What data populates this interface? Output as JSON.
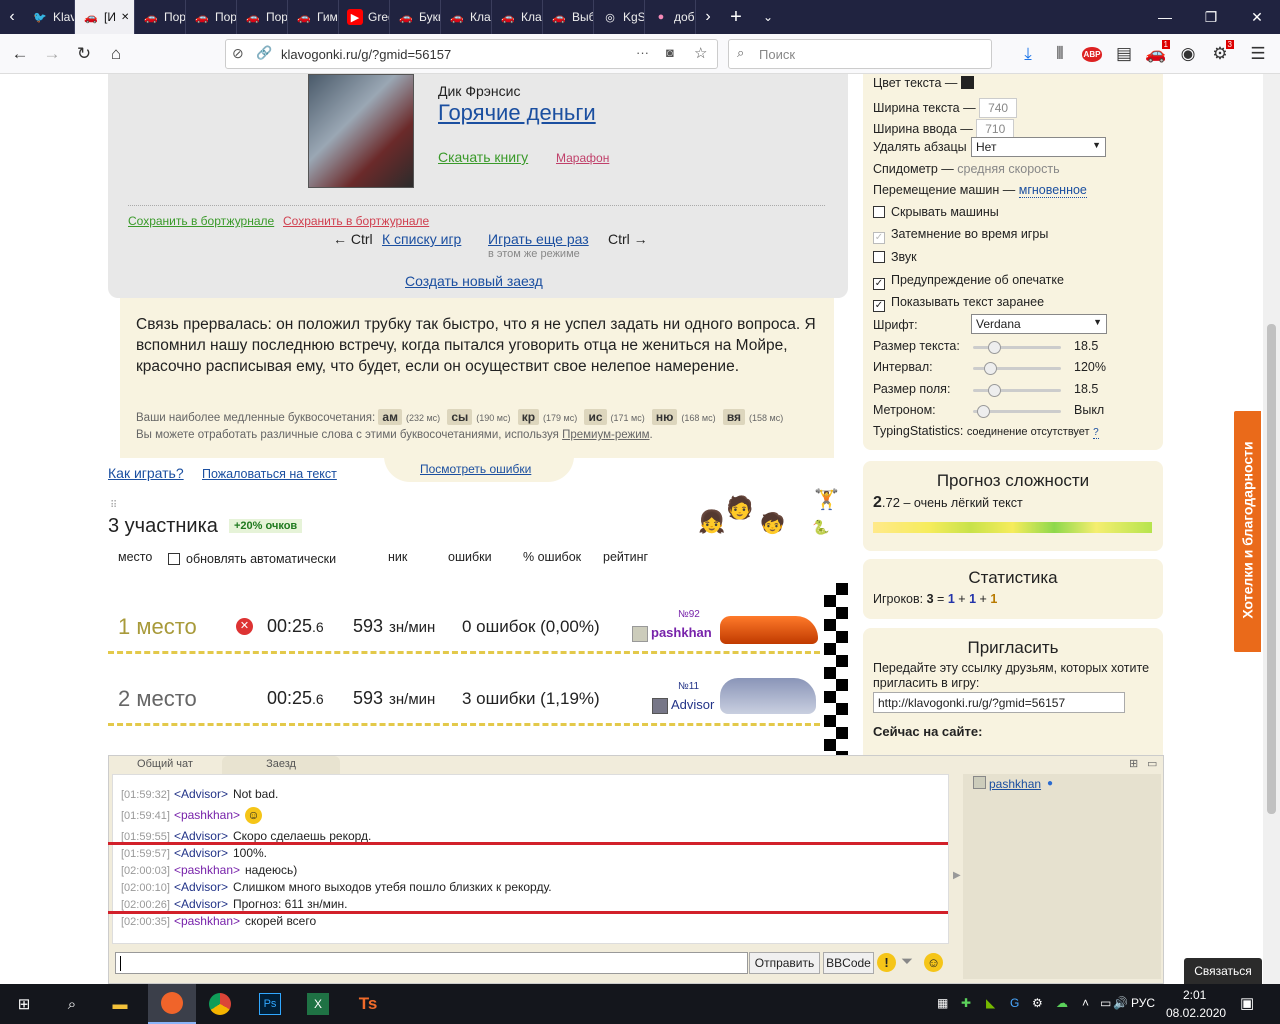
{
  "browser": {
    "tabs": [
      {
        "label": "Klavo",
        "icon": "twitter-icon"
      },
      {
        "label": "[И",
        "icon": "klavogonki-icon",
        "active": true
      },
      {
        "label": "Пора",
        "icon": "klavogonki-icon"
      },
      {
        "label": "Пора",
        "icon": "klavogonki-icon"
      },
      {
        "label": "Пора",
        "icon": "klavogonki-icon"
      },
      {
        "label": "Гимна",
        "icon": "klavogonki-icon"
      },
      {
        "label": "Greg I",
        "icon": "youtube-icon"
      },
      {
        "label": "Буквы",
        "icon": "klavogonki-icon"
      },
      {
        "label": "Клаво",
        "icon": "klavogonki-icon"
      },
      {
        "label": "Клаво",
        "icon": "klavogonki-icon"
      },
      {
        "label": "Выбор",
        "icon": "klavogonki-icon"
      },
      {
        "label": "KgScri",
        "icon": "github-icon"
      },
      {
        "label": "добро",
        "icon": "pink-circle-icon"
      }
    ],
    "url": "klavogonki.ru/g/?gmid=56157",
    "search_placeholder": "Поиск",
    "badge_a": "1",
    "badge_b": "3"
  },
  "book": {
    "author": "Дик Фрэнсис",
    "title": "Горячие деньги",
    "download": "Скачать книгу",
    "mode": "Марафон"
  },
  "actions": {
    "save_green": "Сохранить в бортжурнале",
    "save_red": "Сохранить в бортжурнале",
    "prev_hint": "← Ctrl",
    "to_list": "К списку игр",
    "play_again": "Играть еще раз",
    "next_hint": "Ctrl →",
    "same_mode": "в этом же режиме",
    "new_race": "Создать новый заезд"
  },
  "text_panel": {
    "quote": "Связь прервалась: он положил трубку так быстро, что я не успел задать ни одного вопроса. Я вспомнил нашу последнюю встречу, когда пытался уговорить отца не жениться на Мойре, красочно расписывая ему, что будет, если он осуществит свое нелепое намерение.",
    "slow_label": "Ваши наиболее медленные буквосочетания:",
    "combos": [
      {
        "k": "ам",
        "ms": "(232 мс)"
      },
      {
        "k": "сы",
        "ms": "(190 мс)"
      },
      {
        "k": "кр",
        "ms": "(179 мс)"
      },
      {
        "k": "ис",
        "ms": "(171 мс)"
      },
      {
        "k": "ню",
        "ms": "(168 мс)"
      },
      {
        "k": "вя",
        "ms": "(158 мс)"
      }
    ],
    "practice_pre": "Вы можете отработать различные слова с этими буквосочетаниями, используя",
    "practice_link": "Премиум-режим",
    "practice_post": "."
  },
  "links": {
    "how_to_play": "Как играть?",
    "complain": "Пожаловаться на текст",
    "view_errors": "Посмотреть ошибки"
  },
  "participants": {
    "title": "3 участника",
    "bonus": "+20% очков",
    "cols": {
      "place": "место",
      "auto": "обновлять автоматически",
      "nick": "ник",
      "errors": "ошибки",
      "err_pct": "% ошибок",
      "rating": "рейтинг"
    }
  },
  "results": [
    {
      "place": "1 место",
      "time": "00:25",
      "frac": ".6",
      "speed": "593",
      "unit": "зн/мин",
      "errors": "0 ошибок (0,00%)",
      "num": "№92",
      "nick": "pashkhan"
    },
    {
      "place": "2 место",
      "time": "00:25",
      "frac": ".6",
      "speed": "593",
      "unit": "зн/мин",
      "errors": "3 ошибки (1,19%)",
      "num": "№11",
      "nick": "Advisor"
    }
  ],
  "settings": {
    "text_color": "Цвет текста —",
    "text_width": "Ширина текста —",
    "text_width_val": "740",
    "input_width": "Ширина ввода —",
    "input_width_val": "710",
    "remove_par": "Удалять абзацы",
    "remove_par_val": "Нет",
    "speedometer": "Спидометр —",
    "speedometer_val": "средняя скорость",
    "car_move": "Перемещение машин —",
    "car_move_val": "мгновенное",
    "hide_cars": "Скрывать машины",
    "dim": "Затемнение во время игры",
    "sound": "Звук",
    "typo_warn": "Предупреждение об опечатке",
    "show_text": "Показывать текст заранее",
    "font": "Шрифт:",
    "font_val": "Verdana",
    "text_size": "Размер текста:",
    "text_size_val": "18.5",
    "text_size_level": 0.2,
    "interval": "Интервал:",
    "interval_val": "120%",
    "interval_level": 0.15,
    "field_size": "Размер поля:",
    "field_size_val": "18.5",
    "field_size_level": 0.2,
    "metronome": "Метроном:",
    "metronome_val": "Выкл",
    "metronome_level": 0.05,
    "typing_stats": "TypingStatistics:",
    "typing_stats_val": "соединение отсутствует",
    "typing_stats_q": "?"
  },
  "forecast": {
    "title": "Прогноз сложности",
    "value_big": "2",
    "value_small": ".72",
    "desc": "– очень лёгкий текст"
  },
  "stats": {
    "title": "Статистика",
    "label": "Игроков:",
    "total": "3",
    "eq": "=",
    "a": "1",
    "b": "1",
    "c": "1",
    "plus": "+"
  },
  "invite": {
    "title": "Пригласить",
    "desc": "Передайте эту ссылку друзьям, которых хотите пригласить в игру:",
    "link": "http://klavogonki.ru/g/?gmid=56157",
    "online": "Сейчас на сайте:"
  },
  "wishlist": "Хотелки и благодарности",
  "contact": "Связаться",
  "chat": {
    "tab_general": "Общий чат",
    "tab_race": "Заезд",
    "messages": [
      {
        "t": "[01:59:32]",
        "nick": "<Advisor>",
        "msg": "Not bad."
      },
      {
        "t": "[01:59:41]",
        "nick": "<pashkhan>",
        "msg": "☺"
      },
      {
        "t": "[01:59:55]",
        "nick": "<Advisor>",
        "msg": "Скоро сделаешь рекорд."
      },
      {
        "t": "[01:59:57]",
        "nick": "<Advisor>",
        "msg": "100%."
      },
      {
        "t": "[02:00:03]",
        "nick": "<pashkhan>",
        "msg": "надеюсь)"
      },
      {
        "t": "[02:00:10]",
        "nick": "<Advisor>",
        "msg": "Слишком много выходов утебя пошло близких к рекорду."
      },
      {
        "t": "[02:00:26]",
        "nick": "<Advisor>",
        "msg": "Прогноз: 611 зн/мин."
      },
      {
        "t": "[02:00:35]",
        "nick": "<pashkhan>",
        "msg": "скорей всего"
      }
    ],
    "send": "Отправить",
    "bbcode": "BBCode",
    "user": "pashkhan"
  },
  "taskbar": {
    "lang": "РУС",
    "time": "2:01",
    "date": "08.02.2020"
  }
}
